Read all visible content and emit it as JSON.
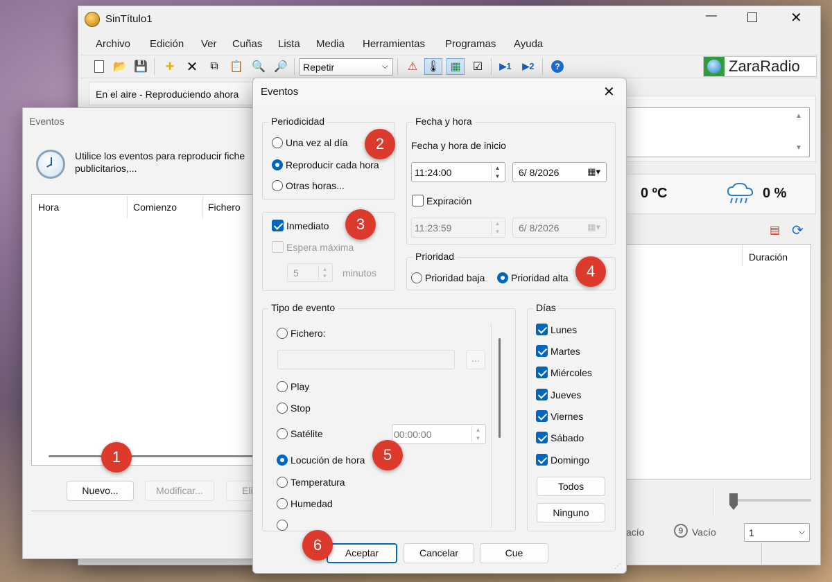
{
  "main_window": {
    "title": "SinTítulo1",
    "menu": [
      "Archivo",
      "Edición",
      "Ver",
      "Cuñas",
      "Lista",
      "Media",
      "Herramientas",
      "Programas",
      "Ayuda"
    ],
    "repeat_select": "Repetir",
    "brand": "ZaraRadio",
    "on_air_label": "En el aire - Reproduciendo ahora",
    "temperature": "0 ºC",
    "humidity": "0 %",
    "duration_header": "Duración",
    "status_empty_left": "acío",
    "status_empty_9": "Vacío",
    "status_select": "1"
  },
  "events_list_window": {
    "title": "Eventos",
    "description": "Utilice los eventos para reproducir fiche",
    "description_line2": "publicitarios,...",
    "columns": [
      "Hora",
      "Comienzo",
      "Fichero"
    ],
    "buttons": {
      "new": "Nuevo...",
      "modify": "Modificar...",
      "delete": "Eli"
    }
  },
  "event_dialog": {
    "title": "Eventos",
    "periodicity": {
      "label": "Periodicidad",
      "options": [
        "Una vez al día",
        "Reproducir cada hora",
        "Otras horas..."
      ]
    },
    "immediate": {
      "label": "Inmediato",
      "max_wait": "Espera máxima",
      "minutes_value": "5",
      "minutes_label": "minutos"
    },
    "date_time": {
      "label": "Fecha y hora",
      "start_label": "Fecha y hora de inicio",
      "start_time": "11:24:00",
      "start_date": "6/ 8/2026",
      "expiration_label": "Expiración",
      "exp_time": "11:23:59",
      "exp_date": "6/ 8/2026"
    },
    "priority": {
      "label": "Prioridad",
      "low": "Prioridad baja",
      "high": "Prioridad alta"
    },
    "event_type": {
      "label": "Tipo de evento",
      "file_label": "Fichero:",
      "browse": "...",
      "play": "Play",
      "stop": "Stop",
      "satellite": "Satélite",
      "satellite_time": "00:00:00",
      "time_announce": "Locución de hora",
      "temperature": "Temperatura",
      "humidity": "Humedad"
    },
    "days": {
      "label": "Días",
      "items": [
        "Lunes",
        "Martes",
        "Miércoles",
        "Jueves",
        "Viernes",
        "Sábado",
        "Domingo"
      ],
      "all": "Todos",
      "none": "Ninguno"
    },
    "buttons": {
      "accept": "Aceptar",
      "cancel": "Cancelar",
      "cue": "Cue"
    }
  },
  "callouts": [
    "1",
    "2",
    "3",
    "4",
    "5",
    "6"
  ],
  "colors": {
    "accent": "#0067c0",
    "callout": "#dd3a2e",
    "brand_green": "#2e9d3a"
  }
}
